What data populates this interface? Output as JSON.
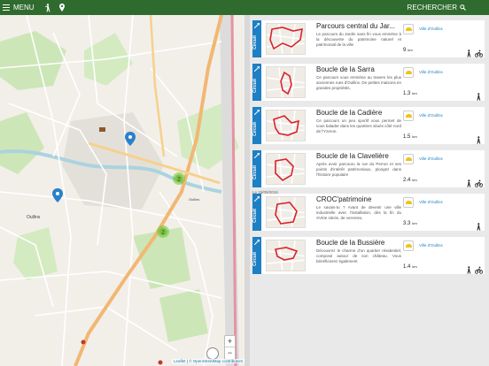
{
  "topbar": {
    "menu_label": "MENU",
    "search_label": "RECHERCHER"
  },
  "map": {
    "attribution_leaflet": "Leaflet",
    "attribution_osm": "© OpenStreetMap contributors",
    "zoom_in": "+",
    "zoom_out": "−",
    "cluster_counts": [
      "2",
      "2"
    ],
    "place_labels": [
      "Oullins",
      "Oullins"
    ]
  },
  "colors": {
    "topbar": "#2f6b2e",
    "card_tag": "#1d7fc4",
    "route": "#d9222a"
  },
  "list": {
    "date_label": "Le 15/09/2016",
    "cards": [
      {
        "tag": "Circuit",
        "title": "Parcours central du Jar...",
        "desc": "Le parcours du Jardin sans fin vous emmène à la découverte du patrimoine naturel et patrimonial de la ville",
        "municipality": "Ville d'Oullins",
        "distance": "9",
        "unit": "km",
        "activities": [
          "walking-icon",
          "cycling-icon"
        ]
      },
      {
        "tag": "Circuit",
        "title": "Boucle de la Sarra",
        "desc": "Ce parcours vous emmène au travers les plus anciennes rues d'Oullins. De petites maisons en grandes propriétés,",
        "municipality": "Ville d'Oullins",
        "distance": "1.3",
        "unit": "km",
        "activities": [
          "walking-icon"
        ]
      },
      {
        "tag": "Circuit",
        "title": "Boucle de la Cadière",
        "desc": "Ce parcours un peu sportif vous permet de vous balader dans les quartiers situés côté nord de l'Yzeron.",
        "municipality": "Ville d'Oullins",
        "distance": "1.5",
        "unit": "km",
        "activities": [
          "walking-icon"
        ]
      },
      {
        "tag": "Circuit",
        "title": "Boucle de la Clavelière",
        "desc": "Après avoir parcouru la rue du Perron et ses points d'intérêt patrimoniaux, plongez dans l'histoire populaire",
        "municipality": "Ville d'Oullins",
        "distance": "2.4",
        "unit": "km",
        "activities": [
          "walking-icon",
          "cycling-icon"
        ]
      },
      {
        "tag": "Circuit",
        "title": "CROC'patrimoine",
        "desc": "Le savais-tu ? Avant de devenir une ville industrielle avec l'installation, dès la fin du XVIIIe siècle, de verreries,",
        "municipality": "Ville d'Oullins",
        "distance": "3.3",
        "unit": "km",
        "activities": [
          "walking-icon"
        ]
      },
      {
        "tag": "Circuit",
        "title": "Boucle de la Bussière",
        "desc": "Découvrez le charme d'un quartier résidentiel, composé autour de son château. Vous bénéficierez également",
        "municipality": "Ville d'Oullins",
        "distance": "1.4",
        "unit": "km",
        "activities": [
          "walking-icon",
          "cycling-icon"
        ]
      }
    ]
  }
}
